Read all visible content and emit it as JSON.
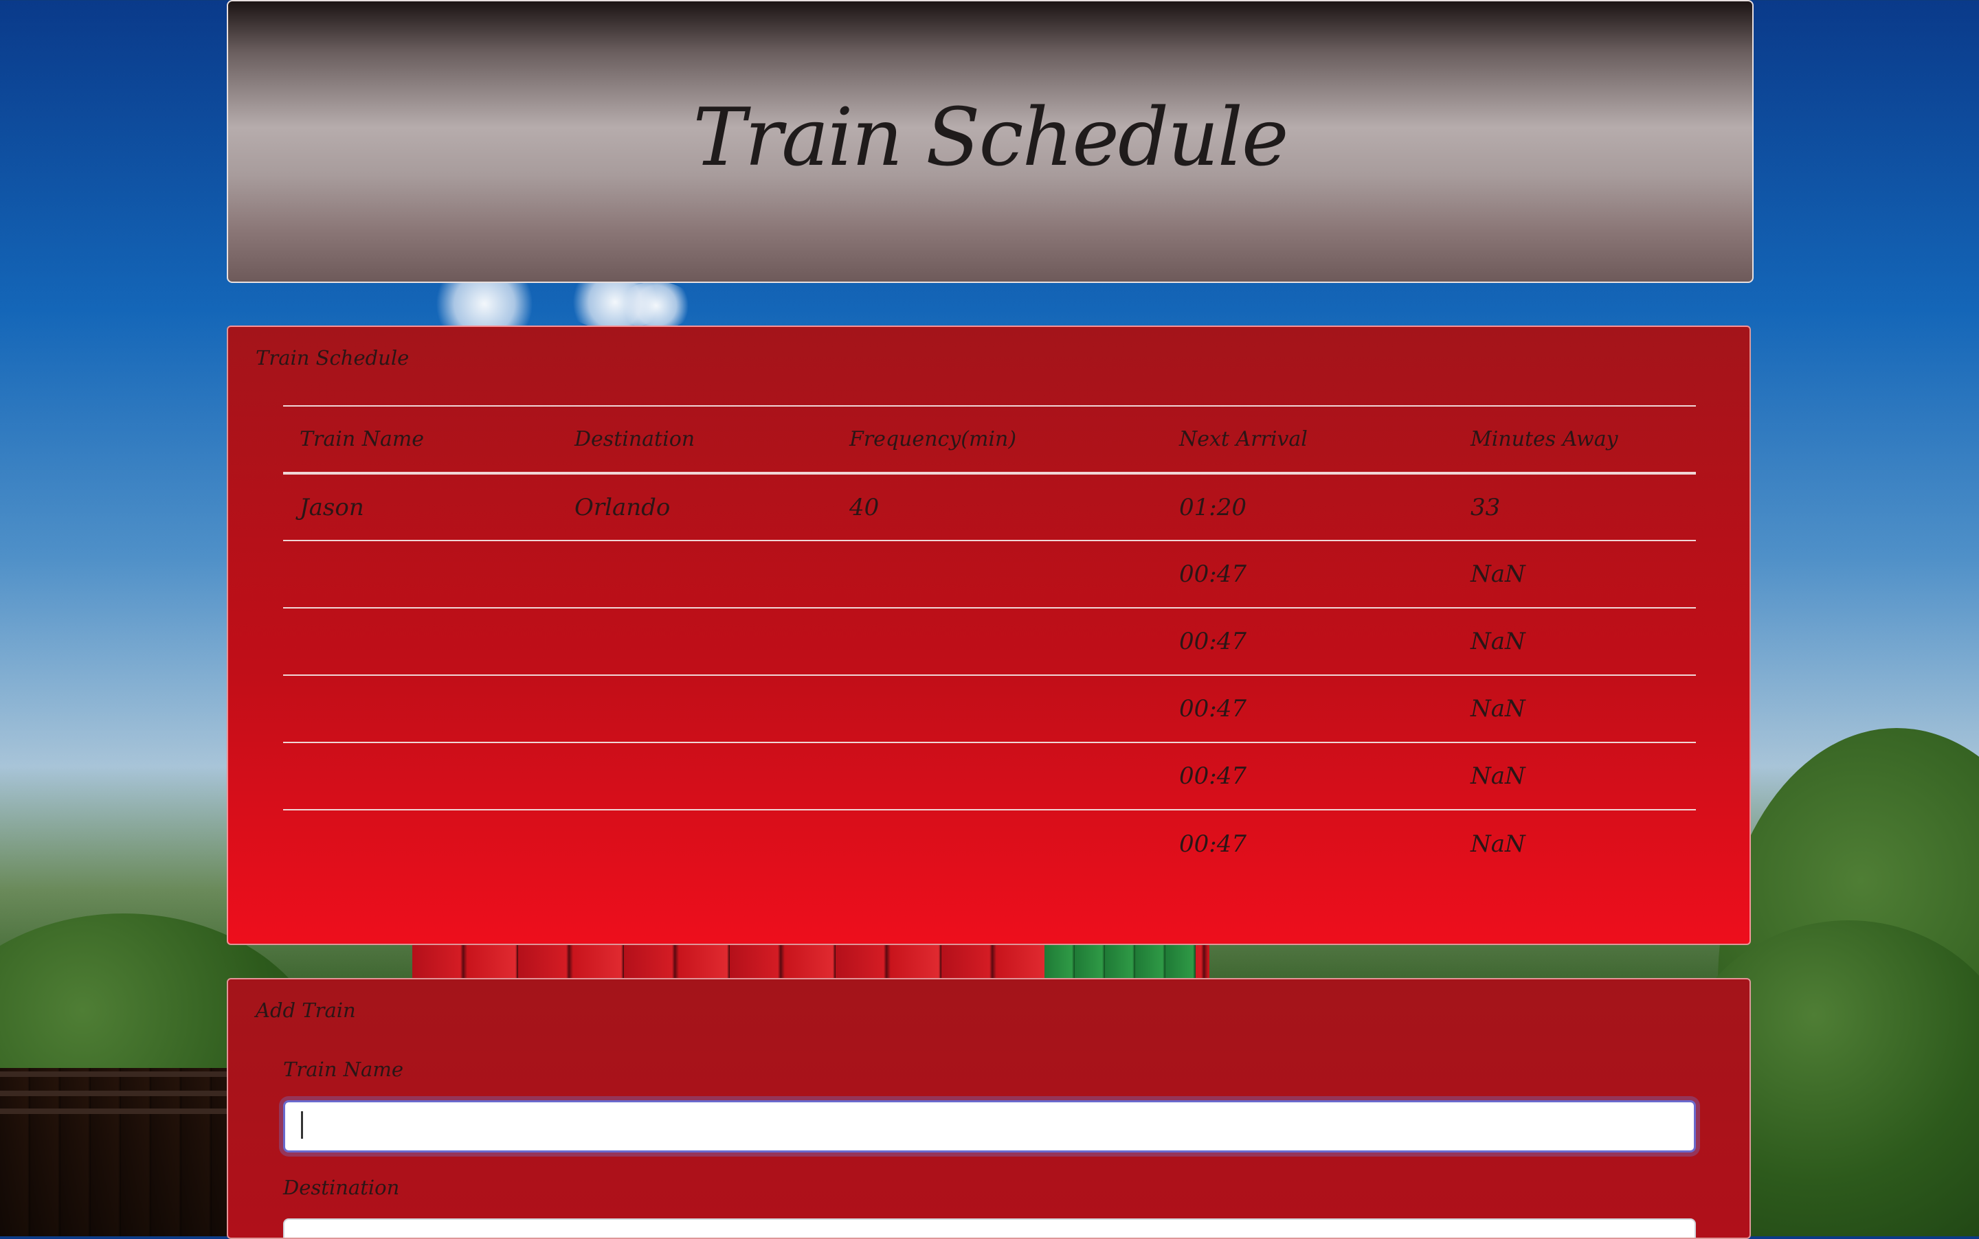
{
  "header": {
    "title": "Train Schedule"
  },
  "schedule_panel": {
    "heading": "Train Schedule",
    "columns": [
      "Train Name",
      "Destination",
      "Frequency(min)",
      "Next Arrival",
      "Minutes Away"
    ],
    "rows": [
      {
        "name": "Jason",
        "destination": "Orlando",
        "frequency": "40",
        "next_arrival": "01:20",
        "minutes_away": "33"
      },
      {
        "name": "",
        "destination": "",
        "frequency": "",
        "next_arrival": "00:47",
        "minutes_away": "NaN"
      },
      {
        "name": "",
        "destination": "",
        "frequency": "",
        "next_arrival": "00:47",
        "minutes_away": "NaN"
      },
      {
        "name": "",
        "destination": "",
        "frequency": "",
        "next_arrival": "00:47",
        "minutes_away": "NaN"
      },
      {
        "name": "",
        "destination": "",
        "frequency": "",
        "next_arrival": "00:47",
        "minutes_away": "NaN"
      },
      {
        "name": "",
        "destination": "",
        "frequency": "",
        "next_arrival": "00:47",
        "minutes_away": "NaN"
      }
    ]
  },
  "add_panel": {
    "heading": "Add Train",
    "fields": {
      "train_name": {
        "label": "Train Name",
        "value": ""
      },
      "destination": {
        "label": "Destination",
        "value": ""
      }
    }
  },
  "colors": {
    "panel_red": "#c00e18",
    "focus_ring": "#6a6acd"
  }
}
